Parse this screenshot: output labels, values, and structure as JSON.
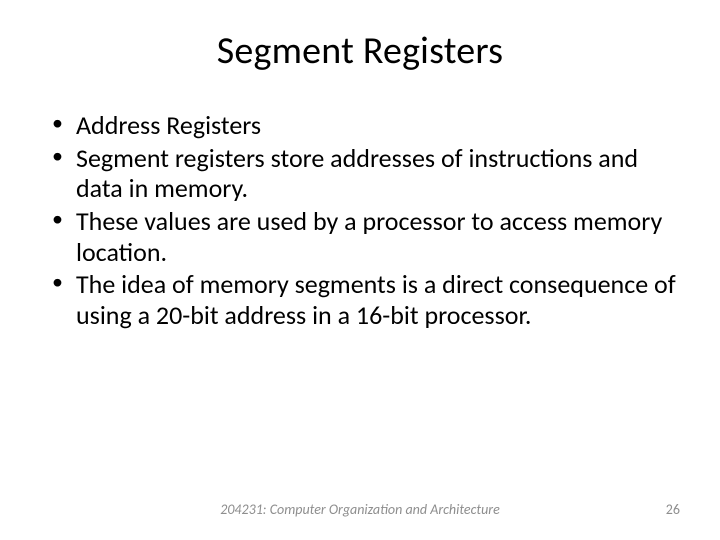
{
  "title": "Segment Registers",
  "bullets": [
    "Address Registers",
    "Segment registers store addresses of instructions and data in memory.",
    "These values are used by a processor to access memory location.",
    "The idea of memory segments is a direct consequence of using a 20-bit address in a 16-bit processor."
  ],
  "footer": "204231: Computer Organization and Architecture",
  "page": "26"
}
